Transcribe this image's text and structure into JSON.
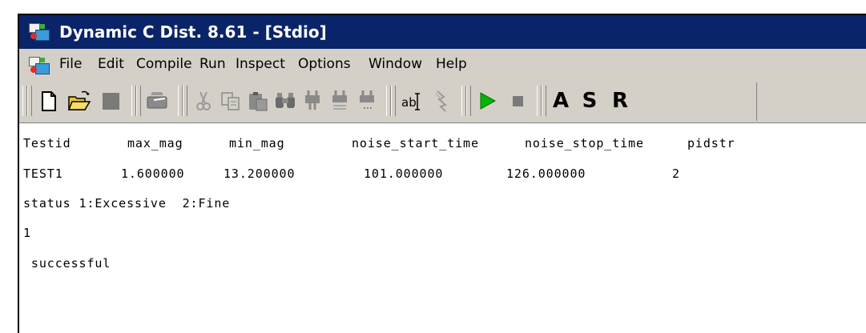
{
  "window": {
    "title": "Dynamic C Dist. 8.61 - [Stdio]"
  },
  "menubar": {
    "items": [
      "File",
      "Edit",
      "Compile",
      "Run",
      "Inspect",
      "Options",
      "Window",
      "Help"
    ]
  },
  "toolbar": {
    "buttons": [
      "new-file",
      "open-file",
      "save-file",
      "print",
      "cut",
      "copy",
      "paste",
      "find",
      "compile",
      "compile-to-target",
      "compile-project",
      "replace-text",
      "toggle-breakpoint",
      "run",
      "stop",
      "assembly",
      "stack",
      "registers"
    ],
    "letters": {
      "assembly": "A",
      "stack": "S",
      "registers": "R"
    },
    "run_color": "#00b400",
    "stop_color": "#7a7a7a"
  },
  "stdio": {
    "header": [
      "Testid",
      "max_mag",
      "min_mag",
      "noise_start_time",
      "noise_stop_time",
      "pidstr"
    ],
    "row": [
      "TEST1",
      "1.600000",
      "13.200000",
      "101.000000",
      "126.000000",
      "2"
    ],
    "status_legend": "status 1:Excessive  2:Fine",
    "status_value": "1",
    "result": " successful"
  },
  "colors": {
    "titlebar": "#0a246a",
    "chrome": "#d4d0c8"
  }
}
